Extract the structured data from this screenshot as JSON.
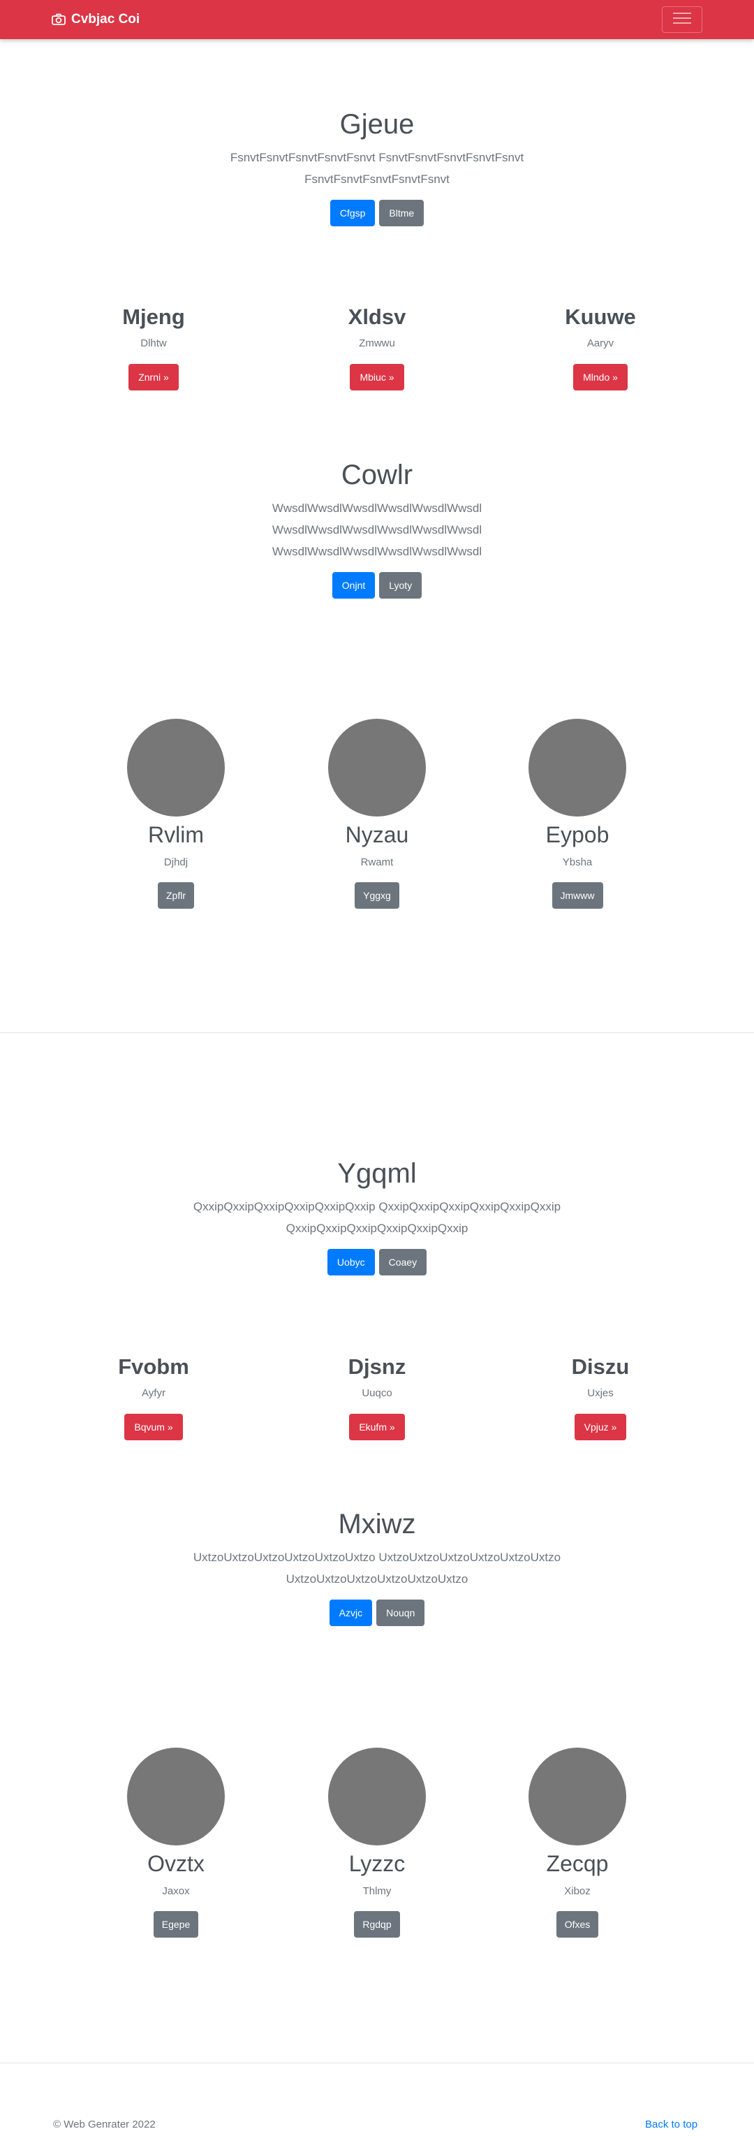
{
  "navbar": {
    "brand": "Cvbjac Coi",
    "brand_icon": "camera-icon",
    "toggler_icon": "hamburger-menu-icon",
    "color": "#dc3545"
  },
  "section1": {
    "title": "Gjeue",
    "lead_line1": "FsnvtFsnvtFsnvtFsnvtFsnvt FsnvtFsnvtFsnvtFsnvtFsnvt",
    "lead_line2": "FsnvtFsnvtFsnvtFsnvtFsnvt",
    "primary_label": "Cfgsp",
    "secondary_label": "Bltme"
  },
  "columns1": [
    {
      "heading": "Mjeng",
      "text": "Dlhtw",
      "button": "Znrni »"
    },
    {
      "heading": "Xldsv",
      "text": "Zmwwu",
      "button": "Mbiuc »"
    },
    {
      "heading": "Kuuwe",
      "text": "Aaryv",
      "button": "Mlndo »"
    }
  ],
  "section2": {
    "title": "Cowlr",
    "lead_line1": "WwsdlWwsdlWwsdlWwsdlWwsdlWwsdl",
    "lead_line2": "WwsdlWwsdlWwsdlWwsdlWwsdlWwsdl",
    "lead_line3": "WwsdlWwsdlWwsdlWwsdlWwsdlWwsdl",
    "primary_label": "Onjnt",
    "secondary_label": "Lyoty"
  },
  "circles1": [
    {
      "name": "Rvlim",
      "text": "Djhdj",
      "button": "Zpflr"
    },
    {
      "name": "Nyzau",
      "text": "Rwamt",
      "button": "Yggxg"
    },
    {
      "name": "Eypob",
      "text": "Ybsha",
      "button": "Jmwww"
    }
  ],
  "section3": {
    "title": "Ygqml",
    "lead_line1": "QxxipQxxipQxxipQxxipQxxipQxxip QxxipQxxipQxxipQxxipQxxipQxxip",
    "lead_line2": "QxxipQxxipQxxipQxxipQxxipQxxip",
    "primary_label": "Uobyc",
    "secondary_label": "Coaey"
  },
  "columns2": [
    {
      "heading": "Fvobm",
      "text": "Ayfyr",
      "button": "Bqvum »"
    },
    {
      "heading": "Djsnz",
      "text": "Uuqco",
      "button": "Ekufm »"
    },
    {
      "heading": "Diszu",
      "text": "Uxjes",
      "button": "Vpjuz »"
    }
  ],
  "section4": {
    "title": "Mxiwz",
    "lead_line1": "UxtzoUxtzoUxtzoUxtzoUxtzoUxtzo UxtzoUxtzoUxtzoUxtzoUxtzoUxtzo",
    "lead_line2": "UxtzoUxtzoUxtzoUxtzoUxtzoUxtzo",
    "primary_label": "Azvjc",
    "secondary_label": "Nouqn"
  },
  "circles2": [
    {
      "name": "Ovztx",
      "text": "Jaxox",
      "button": "Egepe"
    },
    {
      "name": "Lyzzc",
      "text": "Thlmy",
      "button": "Rgdqp"
    },
    {
      "name": "Zecqp",
      "text": "Xiboz",
      "button": "Ofxes"
    }
  ],
  "footer": {
    "copyright": "© Web Genrater 2022",
    "back_to_top": "Back to top"
  }
}
